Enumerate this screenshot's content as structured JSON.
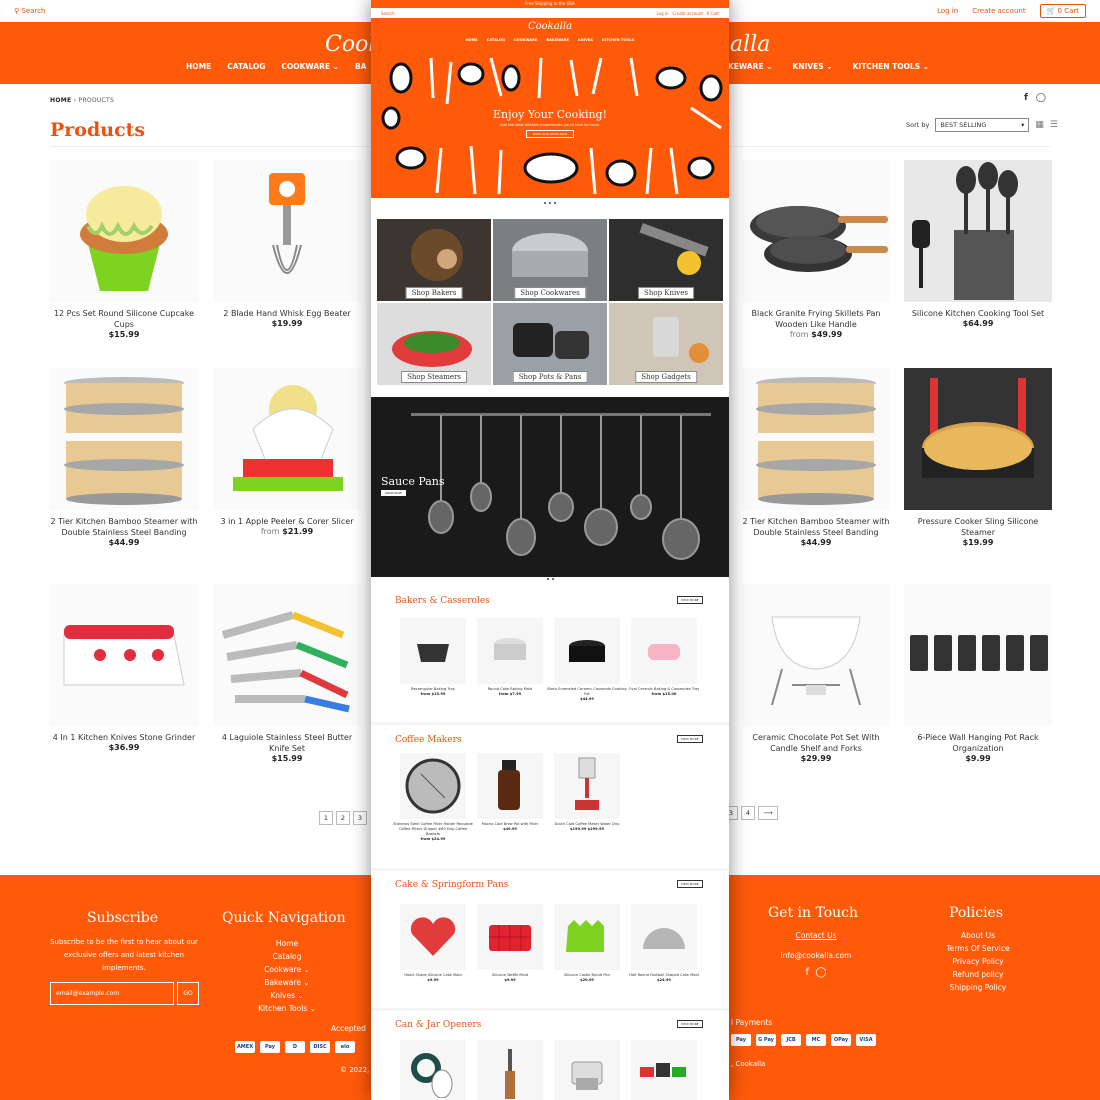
{
  "top_bar": {
    "search_label": "Search",
    "login": "Log in",
    "create_account": "Create account",
    "cart": "0 Cart"
  },
  "brand": {
    "logo_left": "Cook",
    "logo_right": "alla"
  },
  "nav_left": [
    "HOME",
    "CATALOG",
    "COOKWARE ⌄",
    "BA"
  ],
  "nav_right": [
    "KEWARE ⌄",
    "KNIVES ⌄",
    "KITCHEN TOOLS ⌄"
  ],
  "breadcrumb": {
    "home": "HOME",
    "sep": " › ",
    "current": "PRODUCTS"
  },
  "page_title": "Products",
  "sort": {
    "label": "Sort by",
    "value": "BEST SELLING"
  },
  "products": [
    {
      "name": "12 Pcs Set Round Silicone Cupcake Cups",
      "price": "$15.99",
      "from": ""
    },
    {
      "name": "2 Blade Hand Whisk Egg Beater",
      "price": "$19.99",
      "from": ""
    },
    {
      "name": "Black Granite Frying Skillets Pan Wooden Like Handle",
      "price": "$49.99",
      "from": "from"
    },
    {
      "name": "Silicone Kitchen Cooking Tool Set",
      "price": "$64.99",
      "from": ""
    },
    {
      "name": "2 Tier Kitchen Bamboo Steamer with Double Stainless Steel Banding",
      "price": "$44.99",
      "from": ""
    },
    {
      "name": "3 in 1 Apple Peeler & Corer Slicer",
      "price": "$21.99",
      "from": "from"
    },
    {
      "name": "2 Tier Kitchen Bamboo Steamer with Double Stainless Steel Banding",
      "price": "$44.99",
      "from": ""
    },
    {
      "name": "Pressure Cooker Sling Silicone Steamer",
      "price": "$19.99",
      "from": ""
    },
    {
      "name": "4 In 1 Kitchen Knives Stone Grinder",
      "price": "$36.99",
      "from": ""
    },
    {
      "name": "4 Laguiole Stainless Steel Butter Knife Set",
      "price": "$15.99",
      "from": ""
    },
    {
      "name": "Ceramic Chocolate Pot Set With Candle Shelf and Forks",
      "price": "$29.99",
      "from": ""
    },
    {
      "name": "6-Piece Wall Hanging Pot Rack Organization",
      "price": "$9.99",
      "from": ""
    }
  ],
  "pager_left": [
    "1",
    "2",
    "3"
  ],
  "pager_right": [
    "3",
    "4",
    "⟶"
  ],
  "footer": {
    "subscribe_title": "Subscribe",
    "subscribe_text": "Subscribe to be the first to hear about our exclusive offers and latest kitchen implements.",
    "email_placeholder": "email@example.com",
    "go": "GO",
    "quicknav_title": "Quick Navigation",
    "quicknav": [
      "Home",
      "Catalog",
      "Cookware ⌄",
      "Bakeware ⌄",
      "Knives ⌄",
      "Kitchen Tools ⌄"
    ],
    "touch_title": "Get in Touch",
    "contact": "Contact Us",
    "email": "info@cookalla.com",
    "policies_title": "Policies",
    "policies": [
      "About Us",
      "Terms Of Service",
      "Privacy Policy",
      "Refund policy",
      "Shipping Policy"
    ],
    "accepted": "Accepted",
    "payments_label": "l Payments",
    "copyright_left": "© 2022,",
    "copyright_right": ", Cookalla",
    "pay_left": [
      "AMEX",
      "Pay",
      "D",
      "DISC",
      "elo"
    ],
    "pay_right": [
      "Pay",
      "G Pay",
      "JCB",
      "MC",
      "OPay",
      "VISA"
    ]
  },
  "center": {
    "strip": "Free Shipping in the USA",
    "search": "Search",
    "login": "Log in",
    "create": "Create account",
    "cart": "0 Cart",
    "logo": "Cookalla",
    "nav": [
      "HOME",
      "CATALOG",
      "COOKWARE",
      "BAKEWARE",
      "KNIVES",
      "KITCHEN TOOLS"
    ],
    "hero_title": "Enjoy Your Cooking!",
    "hero_sub": "Get the best kitchen implements you'll love to have.",
    "hero_btn": "SHOP OUR ITEMS NOW",
    "tiles": [
      "Shop Bakers",
      "Shop Cookwares",
      "Shop Knives",
      "Shop Steamers",
      "Shop Pots & Pans",
      "Shop Gadgets"
    ],
    "sauce_title": "Sauce Pans",
    "sauce_btn": "SHOP NOW",
    "view_more": "VIEW MORE",
    "sections": [
      {
        "title": "Bakers & Casseroles",
        "items": [
          {
            "name": "Rectangular Baking Tray",
            "price": "from $15.99"
          },
          {
            "name": "Round Cake Baking Mold",
            "price": "from $7.99"
          },
          {
            "name": "Black Enameled Ceramic Casserole Cooking Pot",
            "price": "$44.99"
          },
          {
            "name": "Oval Ceramic Baking & Casseroles Tray",
            "price": "from $15.00"
          }
        ]
      },
      {
        "title": "Coffee Makers",
        "items": [
          {
            "name": "Stainless Steel Coffee Filter Holder Reusable Coffee Filters Dripper #60 Drip Coffee Baskets",
            "price": "from $24.99"
          },
          {
            "name": "Mocha Cold Brew Pot with Filter",
            "price": "$49.99"
          },
          {
            "name": "Dutch Cold Coffee Maker Water Drip",
            "price": "$199.99 $299.99"
          },
          {
            "name": "",
            "price": ""
          }
        ]
      },
      {
        "title": "Cake & Springform Pans",
        "items": [
          {
            "name": "Heart Shape Silicone Cake Mold",
            "price": "$9.99"
          },
          {
            "name": "Silicone Waffle Mold",
            "price": "$9.99"
          },
          {
            "name": "Silicone Castle Bundt Pan",
            "price": "$20.99"
          },
          {
            "name": "Half Round Football Shaped Cake Mold",
            "price": "$24.99"
          }
        ]
      },
      {
        "title": "Can & Jar Openers",
        "items": [
          {
            "name": "",
            "price": ""
          },
          {
            "name": "",
            "price": ""
          },
          {
            "name": "",
            "price": ""
          },
          {
            "name": "",
            "price": ""
          }
        ]
      }
    ]
  },
  "colors": {
    "brand_orange": "#ff5a0a",
    "text_orange": "#e9530f"
  }
}
